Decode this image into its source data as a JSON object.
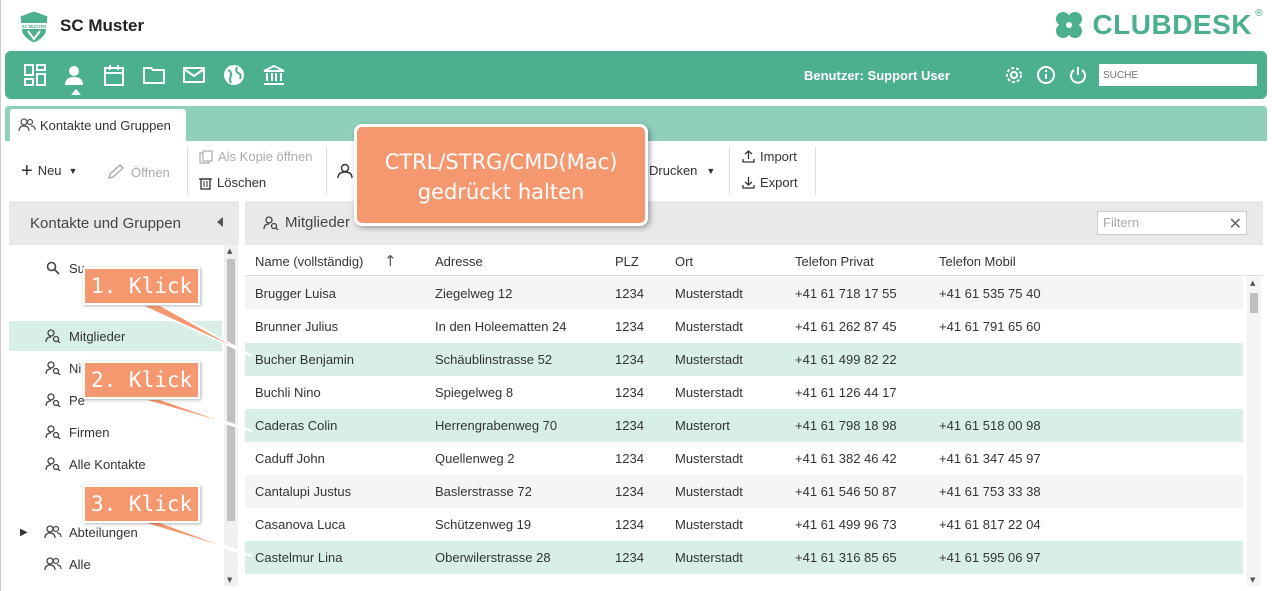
{
  "header": {
    "club_name": "SC Muster",
    "brand": "CLUBDESK",
    "brand_mark": "®",
    "logo_text": "SC MUSTER"
  },
  "nav": {
    "icons": [
      "dashboard-icon",
      "contacts-icon",
      "calendar-icon",
      "folder-icon",
      "mail-icon",
      "globe-icon",
      "bank-icon"
    ],
    "user_label": "Benutzer: Support User",
    "search_placeholder": "SUCHE"
  },
  "tabs": [
    {
      "label": "Kontakte und Gruppen"
    }
  ],
  "toolbar": {
    "new_label": "Neu",
    "open_label": "Öffnen",
    "copy_open_label": "Als Kopie öffnen",
    "delete_label": "Löschen",
    "print_label": "Drucken",
    "import_label": "Import",
    "export_label": "Export"
  },
  "left_panel": {
    "title": "Kontakte und Gruppen",
    "items": [
      {
        "label": "Su"
      },
      {
        "label": "Mitglieder"
      },
      {
        "label": "Ni"
      },
      {
        "label": "Pe"
      },
      {
        "label": "Firmen"
      },
      {
        "label": "Alle Kontakte"
      },
      {
        "label": "Abteilungen"
      },
      {
        "label": "Alle"
      }
    ]
  },
  "right_panel": {
    "title": "Mitglieder",
    "filter_placeholder": "Filtern",
    "columns": [
      "Name (vollständig)",
      "Adresse",
      "PLZ",
      "Ort",
      "Telefon Privat",
      "Telefon Mobil"
    ],
    "rows": [
      {
        "name": "Brugger Luisa",
        "address": "Ziegelweg 12",
        "plz": "1234",
        "city": "Musterstadt",
        "phone": "+41 61 718 17 55",
        "mobile": "+41 61 535 75 40",
        "selected": false
      },
      {
        "name": "Brunner Julius",
        "address": "In den Holeematten 24",
        "plz": "1234",
        "city": "Musterstadt",
        "phone": "+41 61 262 87 45",
        "mobile": "+41 61 791 65 60",
        "selected": false
      },
      {
        "name": "Bucher Benjamin",
        "address": "Schäublinstrasse 52",
        "plz": "1234",
        "city": "Musterstadt",
        "phone": "+41 61 499 82 22",
        "mobile": "",
        "selected": true
      },
      {
        "name": "Buchli Nino",
        "address": "Spiegelweg 8",
        "plz": "1234",
        "city": "Musterstadt",
        "phone": "+41 61 126 44 17",
        "mobile": "",
        "selected": false
      },
      {
        "name": "Caderas Colin",
        "address": "Herrengrabenweg 70",
        "plz": "1234",
        "city": "Musterort",
        "phone": "+41 61 798 18 98",
        "mobile": "+41 61 518 00 98",
        "selected": true
      },
      {
        "name": "Caduff John",
        "address": "Quellenweg 2",
        "plz": "1234",
        "city": "Musterstadt",
        "phone": "+41 61 382 46 42",
        "mobile": "+41 61 347 45 97",
        "selected": false
      },
      {
        "name": "Cantalupi Justus",
        "address": "Baslerstrasse 72",
        "plz": "1234",
        "city": "Musterstadt",
        "phone": "+41 61 546 50 87",
        "mobile": "+41 61 753 33 38",
        "selected": false
      },
      {
        "name": "Casanova Luca",
        "address": "Schützenweg 19",
        "plz": "1234",
        "city": "Musterstadt",
        "phone": "+41 61 499 96 73",
        "mobile": "+41 61 817 22 04",
        "selected": false
      },
      {
        "name": "Castelmur Lina",
        "address": "Oberwilerstrasse 28",
        "plz": "1234",
        "city": "Musterstadt",
        "phone": "+41 61 316 85 65",
        "mobile": "+41 61 595 06 97",
        "selected": true
      }
    ]
  },
  "callouts": {
    "main_line1": "CTRL/STRG/CMD(Mac)",
    "main_line2": "gedrückt halten",
    "step1": "1. Klick",
    "step2": "2. Klick",
    "step3": "3. Klick"
  },
  "colors": {
    "brand_green": "#4caf8f",
    "tab_strip": "#8ed0bb",
    "selection": "#d7efe7",
    "callout": "#f6986f"
  }
}
